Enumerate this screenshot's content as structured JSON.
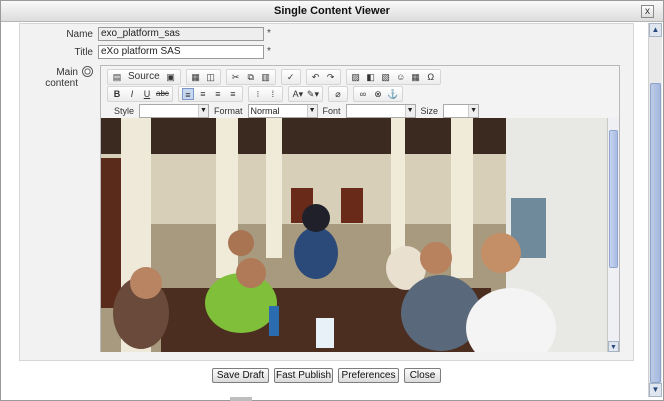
{
  "dialog": {
    "title": "Single Content Viewer",
    "close_glyph": "x"
  },
  "form": {
    "name_label": "Name",
    "name_value": "exo_platform_sas",
    "title_label": "Title",
    "title_value": "eXo platform SAS",
    "required_mark": "*",
    "content_label": "Main content"
  },
  "toolbar": {
    "source_label": "Source",
    "style_label": "Style",
    "style_value": "",
    "format_label": "Format",
    "format_value": "Normal",
    "font_label": "Font",
    "font_value": "",
    "size_label": "Size",
    "size_value": "",
    "bold": "B",
    "italic": "I",
    "underline": "U",
    "strike": "abc",
    "special_char": "Ω"
  },
  "buttons": {
    "save_draft": "Save Draft",
    "fast_publish": "Fast Publish",
    "preferences": "Preferences",
    "close": "Close"
  }
}
